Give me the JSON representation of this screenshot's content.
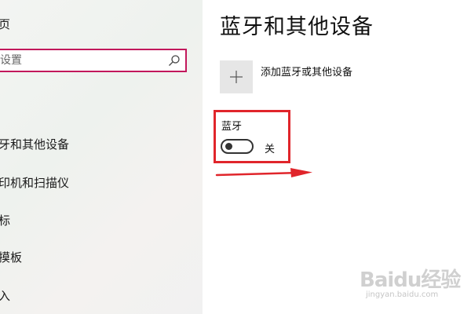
{
  "sidebar": {
    "home_label": "页",
    "search": {
      "placeholder": "设置",
      "value": ""
    },
    "items": [
      {
        "label": "牙和其他设备"
      },
      {
        "label": "印机和扫描仪"
      },
      {
        "label": "标"
      },
      {
        "label": "摸板"
      },
      {
        "label": "入"
      }
    ]
  },
  "main": {
    "title": "蓝牙和其他设备",
    "add_device_label": "添加蓝牙或其他设备",
    "bluetooth": {
      "label": "蓝牙",
      "state_label": "关",
      "on": false
    }
  },
  "watermark": {
    "logo_text": "Baidu经验",
    "url": "jingyan.baidu.com"
  },
  "colors": {
    "highlight": "#e0252b",
    "search_border": "#c2185b",
    "add_tile": "#e6e6e6"
  },
  "icons": {
    "search": "search-icon",
    "add": "plus-icon"
  }
}
